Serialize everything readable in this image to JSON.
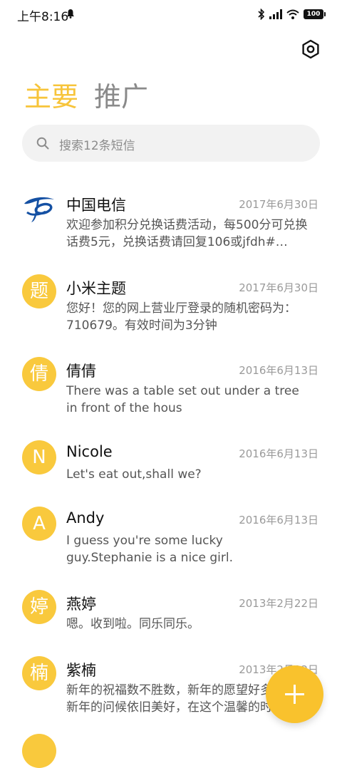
{
  "status": {
    "time": "上午8:16",
    "battery": "100"
  },
  "tabs": [
    {
      "label": "主要"
    },
    {
      "label": "推广"
    }
  ],
  "search": {
    "placeholder": "搜索12条短信"
  },
  "threads": [
    {
      "avatar": "",
      "name": "中国电信",
      "date": "2017年6月30日",
      "preview": "欢迎参加积分兑换话费活动，每500分可兑换话费5元，兑换话费请回复106或jfdh#…"
    },
    {
      "avatar": "题",
      "name": "小米主题",
      "date": "2017年6月30日",
      "preview": "您好！您的网上营业厅登录的随机密码为：710679。有效时间为3分钟"
    },
    {
      "avatar": "倩",
      "name": "倩倩",
      "date": "2016年6月13日",
      "preview": "There was a table set out under a tree in front of the hous"
    },
    {
      "avatar": "N",
      "name": "Nicole",
      "date": "2016年6月13日",
      "preview": "Let's eat out,shall we?"
    },
    {
      "avatar": "A",
      "name": "Andy",
      "date": "2016年6月13日",
      "preview": "I guess you're some lucky guy.Stephanie is a nice girl."
    },
    {
      "avatar": "婷",
      "name": "燕婷",
      "date": "2013年2月22日",
      "preview": "嗯。收到啦。同乐同乐。"
    },
    {
      "avatar": "楠",
      "name": "紫楠",
      "date": "2013年2月22日",
      "preview": "新年的祝福数不胜数，新年的愿望好多好多，新年的问候依旧美好，在这个温馨的时刻"
    }
  ],
  "colors": {
    "accent": "#f7c43a",
    "avatar_bg": "#f9c93d",
    "fab": "#f9c22d"
  }
}
